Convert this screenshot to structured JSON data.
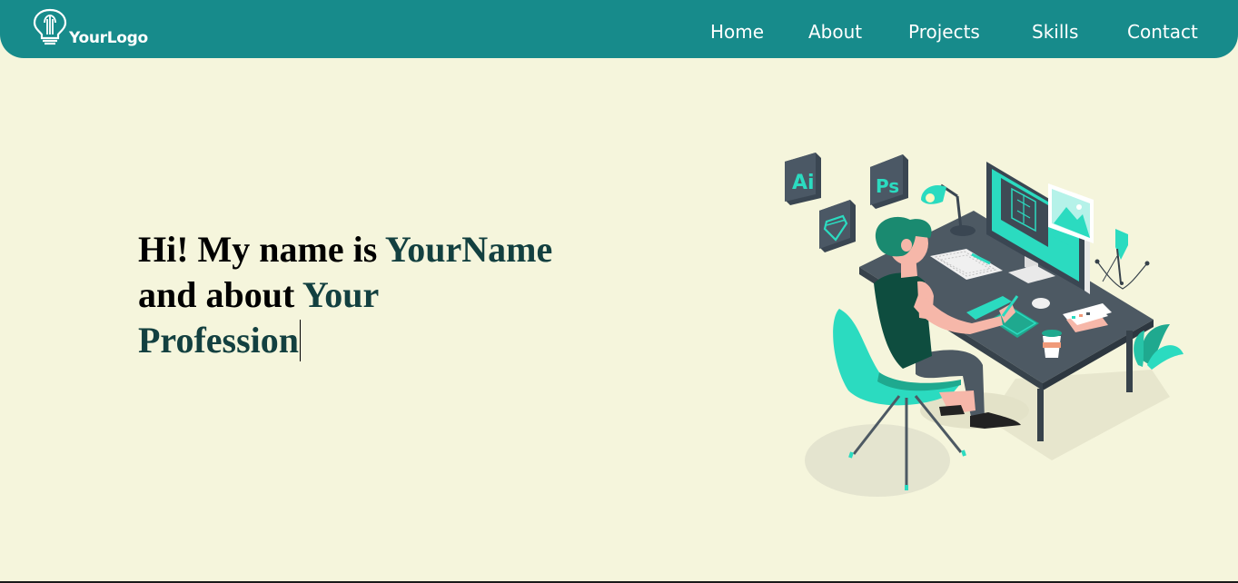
{
  "brand": {
    "logo_text": "YourLogo"
  },
  "nav": {
    "items": [
      {
        "label": "Home"
      },
      {
        "label": "About"
      },
      {
        "label": "Projects"
      },
      {
        "label": "Skills"
      },
      {
        "label": "Contact"
      }
    ]
  },
  "hero": {
    "intro": "Hi! My name is ",
    "name": "YourName",
    "and_about": "and about ",
    "profession_line1": "Your",
    "profession_line2": "Profession"
  },
  "illustration": {
    "badges": [
      "Ai",
      "Ps"
    ]
  },
  "colors": {
    "navbar": "#178b8b",
    "background": "#f5f5dc",
    "accent_text": "#134040",
    "illustration_teal": "#2bdbc0"
  },
  "icons": [
    "lightbulb-logo-icon",
    "diamond-icon",
    "pen-tool-icon"
  ]
}
